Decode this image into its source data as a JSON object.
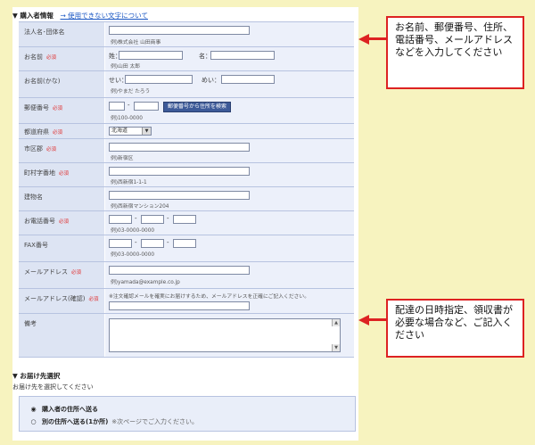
{
  "purchaser_section": {
    "title": "▼ 購入者情報",
    "link_text": "→ 使用できない文字について"
  },
  "required_mark": "必須",
  "fields": {
    "company": {
      "label": "法人名･団体名",
      "hint": "例)株式会社 山田商事"
    },
    "name": {
      "label": "お名前",
      "sei_label": "姓：",
      "mei_label": "名：",
      "hint": "例)山田 太郎"
    },
    "kana": {
      "label": "お名前(かな)",
      "sei_label": "せい：",
      "mei_label": "めい：",
      "hint": "例)やまだ たろう"
    },
    "zip": {
      "label": "郵便番号",
      "dash": "-",
      "button": "郵便番号から住所を検索",
      "hint": "例)100-0000"
    },
    "pref": {
      "label": "都道府県",
      "selected": "北海道"
    },
    "city": {
      "label": "市区郡",
      "hint": "例)新宿区"
    },
    "street": {
      "label": "町村字番地",
      "hint": "例)西新宿1-1-1"
    },
    "building": {
      "label": "建物名",
      "hint": "例)西新宿マンション204"
    },
    "phone": {
      "label": "お電話番号",
      "dash1": "-",
      "dash2": "-",
      "hint": "例)03-0000-0000"
    },
    "fax": {
      "label": "FAX番号",
      "dash1": "-",
      "dash2": "-",
      "hint": "例)03-0000-0000"
    },
    "email": {
      "label": "メールアドレス",
      "hint": "例)yamada@example.co.jp"
    },
    "email_confirm": {
      "label": "メールアドレス(確認)",
      "note": "※注文確認メールを確実にお届けするため、メールアドレスを正確にご記入ください。"
    },
    "remarks": {
      "label": "備考",
      "scroll_up": "▲",
      "scroll_down": "▼"
    }
  },
  "callouts": {
    "top": "お名前、郵便番号、住所、電話番号、メールアドレスなどを入力してください",
    "bottom": "配達の日時指定、領収書が必要な場合など、ご記入ください"
  },
  "shipping": {
    "title": "▼ お届け先選択",
    "description": "お届け先を選択してください",
    "options": [
      {
        "mark": "◉",
        "label": "購入者の住所へ送る",
        "note": ""
      },
      {
        "mark": "○",
        "label": "別の住所へ送る(1か所)",
        "note": "※次ページでご入力ください。"
      }
    ]
  },
  "colors": {
    "background": "#f7f3bf",
    "label_cell": "#dde4f3",
    "value_cell": "#ecf0fa",
    "required": "#e03030",
    "callout_border": "#dd2222",
    "link": "#1a57c4"
  }
}
